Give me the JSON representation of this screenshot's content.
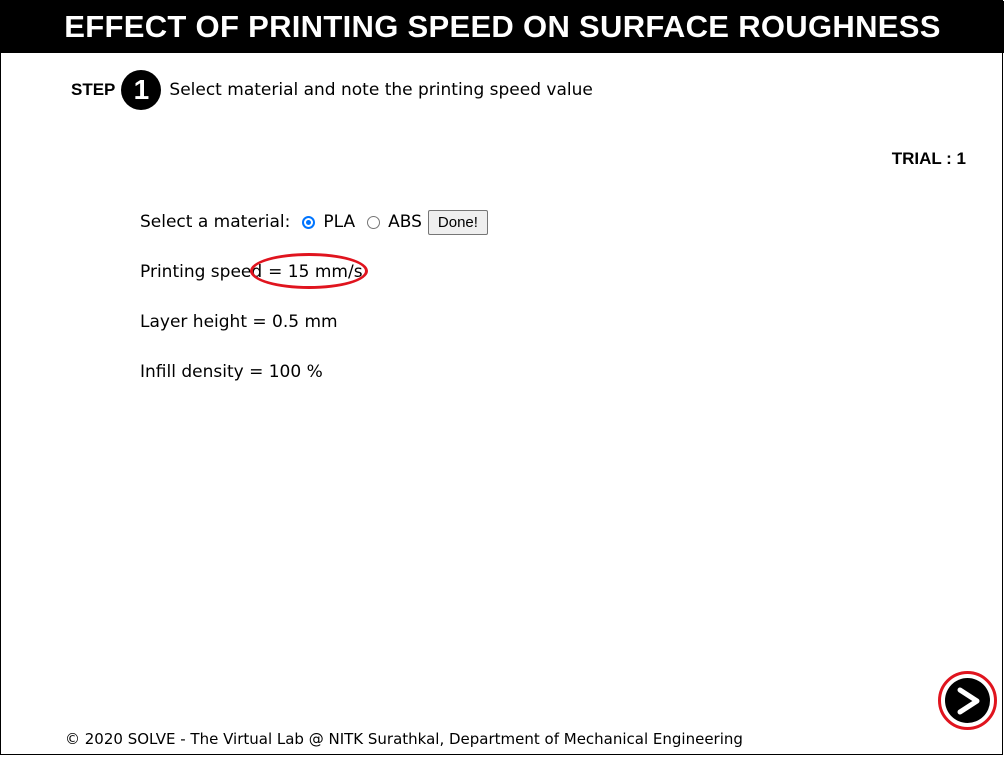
{
  "header": {
    "title": "EFFECT OF PRINTING SPEED ON SURFACE ROUGHNESS"
  },
  "step": {
    "label": "STEP",
    "number": "1",
    "instruction": "Select material and note the printing speed value"
  },
  "trial": {
    "label": "TRIAL : 1"
  },
  "material_select": {
    "label": "Select a material:",
    "options": [
      {
        "label": "PLA",
        "checked": true
      },
      {
        "label": "ABS",
        "checked": false
      }
    ],
    "done_label": "Done!"
  },
  "parameters": {
    "printing_speed_label": "Printing speed",
    "printing_speed_value": "= 15 mm/s",
    "layer_height": "Layer height = 0.5 mm",
    "infill_density": "Infill density = 100 %"
  },
  "footer": {
    "text": "© 2020 SOLVE - The Virtual Lab @ NITK Surathkal, Department of Mechanical Engineering"
  },
  "icons": {
    "step_badge": "number-circle-icon",
    "next": "next-arrow-icon"
  },
  "colors": {
    "header_bg": "#000000",
    "header_text": "#ffffff",
    "highlight": "#e0141e",
    "radio_accent": "#0075ff"
  }
}
